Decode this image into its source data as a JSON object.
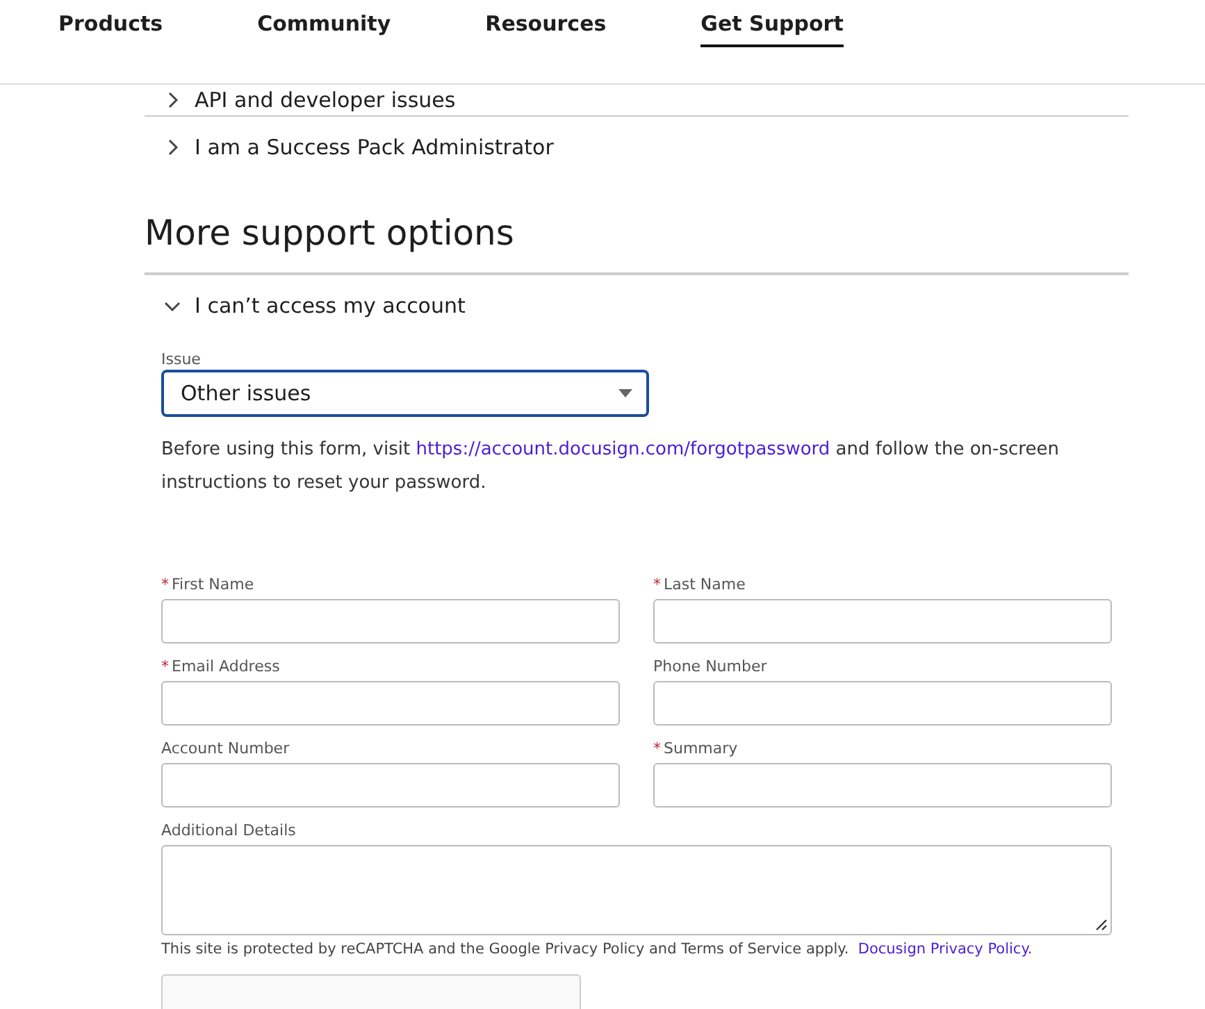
{
  "nav": [
    {
      "label": "Products",
      "selected": false
    },
    {
      "label": "Community",
      "selected": false
    },
    {
      "label": "Resources",
      "selected": false
    },
    {
      "label": "Get Support",
      "selected": true
    }
  ],
  "topics": [
    {
      "label": "API and developer issues",
      "expanded": false
    },
    {
      "label": "I am a Success Pack Administrator",
      "expanded": false
    }
  ],
  "section_title": "More support options",
  "options": [
    {
      "label": "I can’t access my account",
      "expanded": true
    }
  ],
  "issue": {
    "label": "Issue",
    "value": "Other issues"
  },
  "notice": {
    "before": "Before using this form, visit ",
    "link": "https://account.docusign.com/forgotpassword",
    "after": " and follow the on-screen instructions to reset your password."
  },
  "fields": [
    {
      "label": "First Name",
      "required": true,
      "kind": "input"
    },
    {
      "label": "Last Name",
      "required": true,
      "kind": "input"
    },
    {
      "label": "Email Address",
      "required": true,
      "kind": "input"
    },
    {
      "label": "Phone Number",
      "required": false,
      "kind": "input"
    },
    {
      "label": "Account Number",
      "required": false,
      "kind": "input"
    },
    {
      "label": "Summary",
      "required": true,
      "kind": "input"
    },
    {
      "label": "Additional Details",
      "required": false,
      "kind": "textarea"
    }
  ],
  "required_mark": "*",
  "recaptcha_note": {
    "text": "This site is protected by reCAPTCHA and the Google Privacy Policy and Terms of Service apply.",
    "link": "Docusign Privacy Policy."
  }
}
